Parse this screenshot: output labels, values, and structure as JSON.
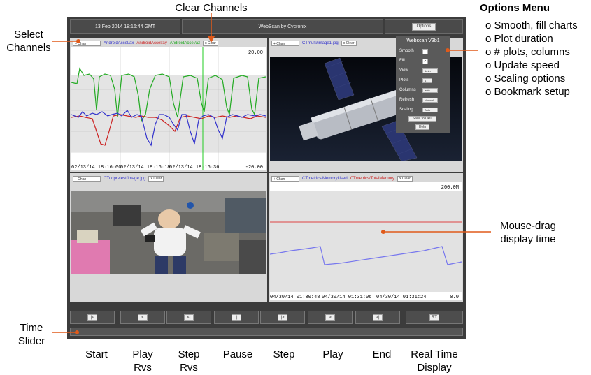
{
  "header": {
    "datetime": "13 Feb 2014 18:16:44 GMT",
    "title": "WebScan by Cycronix",
    "options_button": "Options"
  },
  "panels": [
    {
      "select": "+ Chan",
      "clear": "x Clear",
      "channels": [
        {
          "name": "AndroidAccel/ax",
          "color": "#3333cc"
        },
        {
          "name": "AndroidAccel/ay",
          "color": "#cc2222"
        },
        {
          "name": "AndroidAccel/az",
          "color": "#22aa22"
        }
      ],
      "ymax": "20.00",
      "ymin": "-20.00",
      "xticks": [
        "02/13/14 18:16:00",
        "02/13/14 18:16:18",
        "02/13/14 18:16:36"
      ]
    },
    {
      "select": "+ Chan",
      "clear": "x Clear",
      "channels": [
        {
          "name": "CTmulti/image1.jpg",
          "color": "#3333cc"
        }
      ]
    },
    {
      "select": "+ Chan",
      "clear": "x Clear",
      "channels": [
        {
          "name": "CTudpretest/image.jpg",
          "color": "#3333cc"
        }
      ]
    },
    {
      "select": "+ Chan",
      "clear": "x Clear",
      "channels": [
        {
          "name": "CTmetrics/MemoryUsed",
          "color": "#3333cc"
        },
        {
          "name": "CTmetrics/TotalMemory",
          "color": "#cc2222"
        }
      ],
      "ymax": "200.0M",
      "ymin": "0.0",
      "xticks": [
        "04/30/14 01:30:48",
        "04/30/14 01:31:06",
        "04/30/14 01:31:24"
      ]
    }
  ],
  "options_menu": {
    "title": "Webscan V3b1",
    "rows": [
      {
        "label": "Smooth",
        "value": ""
      },
      {
        "label": "Fill",
        "value": ""
      },
      {
        "label": "View",
        "value": "1min"
      },
      {
        "label": "Plots",
        "value": "4"
      },
      {
        "label": "Columns",
        "value": "auto"
      },
      {
        "label": "Refresh",
        "value": "Normal"
      },
      {
        "label": "Scaling",
        "value": "Auto"
      }
    ],
    "smooth_checked": false,
    "fill_checked": true,
    "save_button": "Save to URL",
    "help_button": "Help"
  },
  "playback": {
    "buttons": [
      "|<",
      "<",
      "<|",
      "||",
      "|>",
      ">",
      ">|",
      "RT"
    ]
  },
  "annotations": {
    "clear_channels": "Clear Channels",
    "select_channels": [
      "Select",
      "Channels"
    ],
    "options_title": "Options Menu",
    "options_items": [
      "o Smooth, fill charts",
      "o Plot duration",
      "o # plots, columns",
      "o Update speed",
      "o Scaling options",
      "o Bookmark setup"
    ],
    "mouse_drag": [
      "Mouse-drag",
      "display time"
    ],
    "time_slider": [
      "Time",
      "Slider"
    ],
    "button_labels": [
      [
        "Start"
      ],
      [
        "Play",
        "Rvs"
      ],
      [
        "Step",
        "Rvs"
      ],
      [
        "Pause"
      ],
      [
        "Step"
      ],
      [
        "Play"
      ],
      [
        "End"
      ],
      [
        "Real Time",
        "Display"
      ]
    ]
  },
  "colors": {
    "annotation_line": "#e05a1a",
    "series_blue": "#3333cc",
    "series_red": "#cc2222",
    "series_green": "#22aa22"
  }
}
